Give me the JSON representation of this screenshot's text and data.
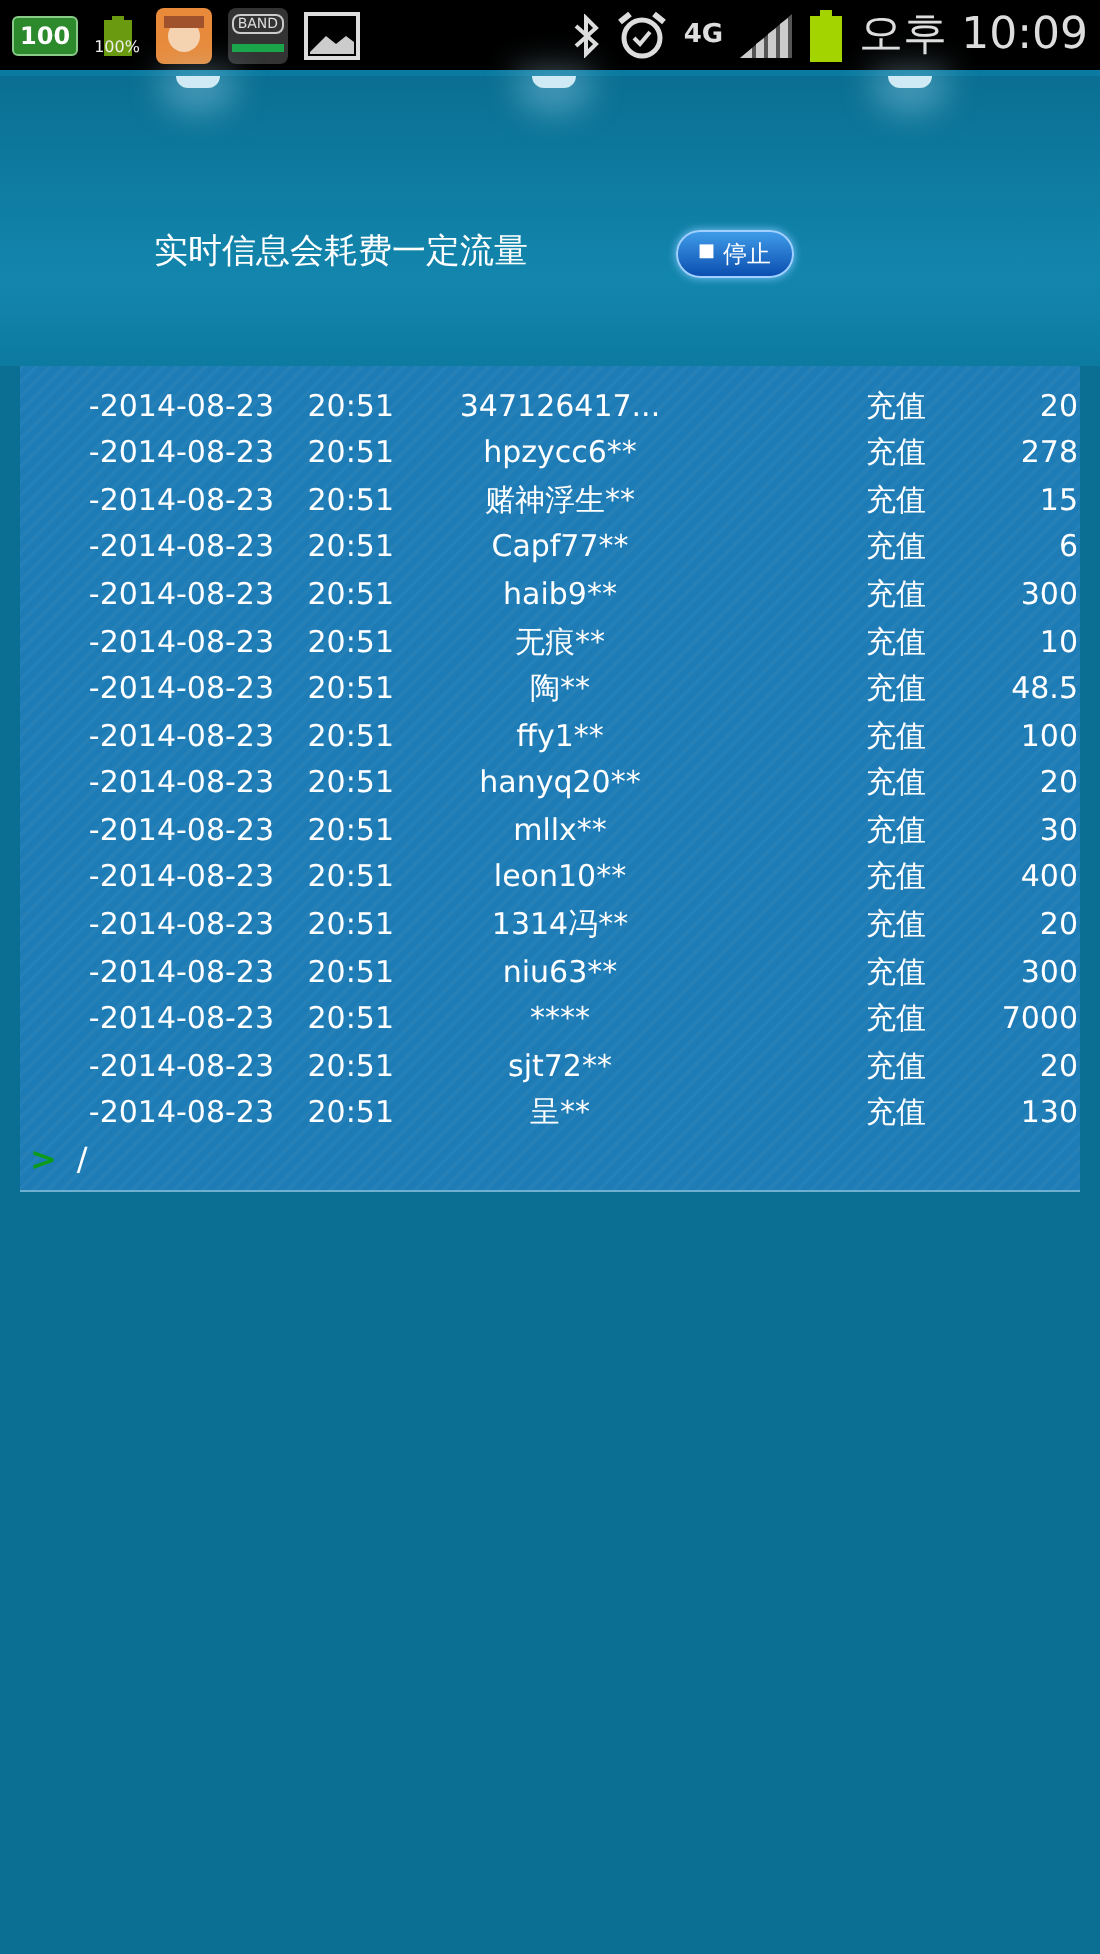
{
  "status_bar": {
    "battery_badge": "100",
    "battery_percent": "100%",
    "band_label": "BAND",
    "network": "4G",
    "time": "오후 10:09"
  },
  "header": {
    "notice": "实时信息会耗费一定流量",
    "stop_button": {
      "icon": "■",
      "label": "停止"
    }
  },
  "feed": {
    "rows": [
      {
        "date": "-2014-08-23",
        "time": "20:51",
        "user": "347126417...",
        "type": "充值",
        "amount": "20"
      },
      {
        "date": "-2014-08-23",
        "time": "20:51",
        "user": "hpzycc6**",
        "type": "充值",
        "amount": "278"
      },
      {
        "date": "-2014-08-23",
        "time": "20:51",
        "user": "赌神浮生**",
        "type": "充值",
        "amount": "15"
      },
      {
        "date": "-2014-08-23",
        "time": "20:51",
        "user": "Capf77**",
        "type": "充值",
        "amount": "6"
      },
      {
        "date": "-2014-08-23",
        "time": "20:51",
        "user": "haib9**",
        "type": "充值",
        "amount": "300"
      },
      {
        "date": "-2014-08-23",
        "time": "20:51",
        "user": "无痕**",
        "type": "充值",
        "amount": "10"
      },
      {
        "date": "-2014-08-23",
        "time": "20:51",
        "user": "陶**",
        "type": "充值",
        "amount": "48.5"
      },
      {
        "date": "-2014-08-23",
        "time": "20:51",
        "user": "ffy1**",
        "type": "充值",
        "amount": "100"
      },
      {
        "date": "-2014-08-23",
        "time": "20:51",
        "user": "hanyq20**",
        "type": "充值",
        "amount": "20"
      },
      {
        "date": "-2014-08-23",
        "time": "20:51",
        "user": "mllx**",
        "type": "充值",
        "amount": "30"
      },
      {
        "date": "-2014-08-23",
        "time": "20:51",
        "user": "leon10**",
        "type": "充值",
        "amount": "400"
      },
      {
        "date": "-2014-08-23",
        "time": "20:51",
        "user": "1314冯**",
        "type": "充值",
        "amount": "20"
      },
      {
        "date": "-2014-08-23",
        "time": "20:51",
        "user": "niu63**",
        "type": "充值",
        "amount": "300"
      },
      {
        "date": "-2014-08-23",
        "time": "20:51",
        "user": "****",
        "type": "充值",
        "amount": "7000"
      },
      {
        "date": "-2014-08-23",
        "time": "20:51",
        "user": "sjt72**",
        "type": "充值",
        "amount": "20"
      },
      {
        "date": "-2014-08-23",
        "time": "20:51",
        "user": "呈**",
        "type": "充值",
        "amount": "130"
      }
    ],
    "prompt": ">",
    "spinner": "/"
  }
}
